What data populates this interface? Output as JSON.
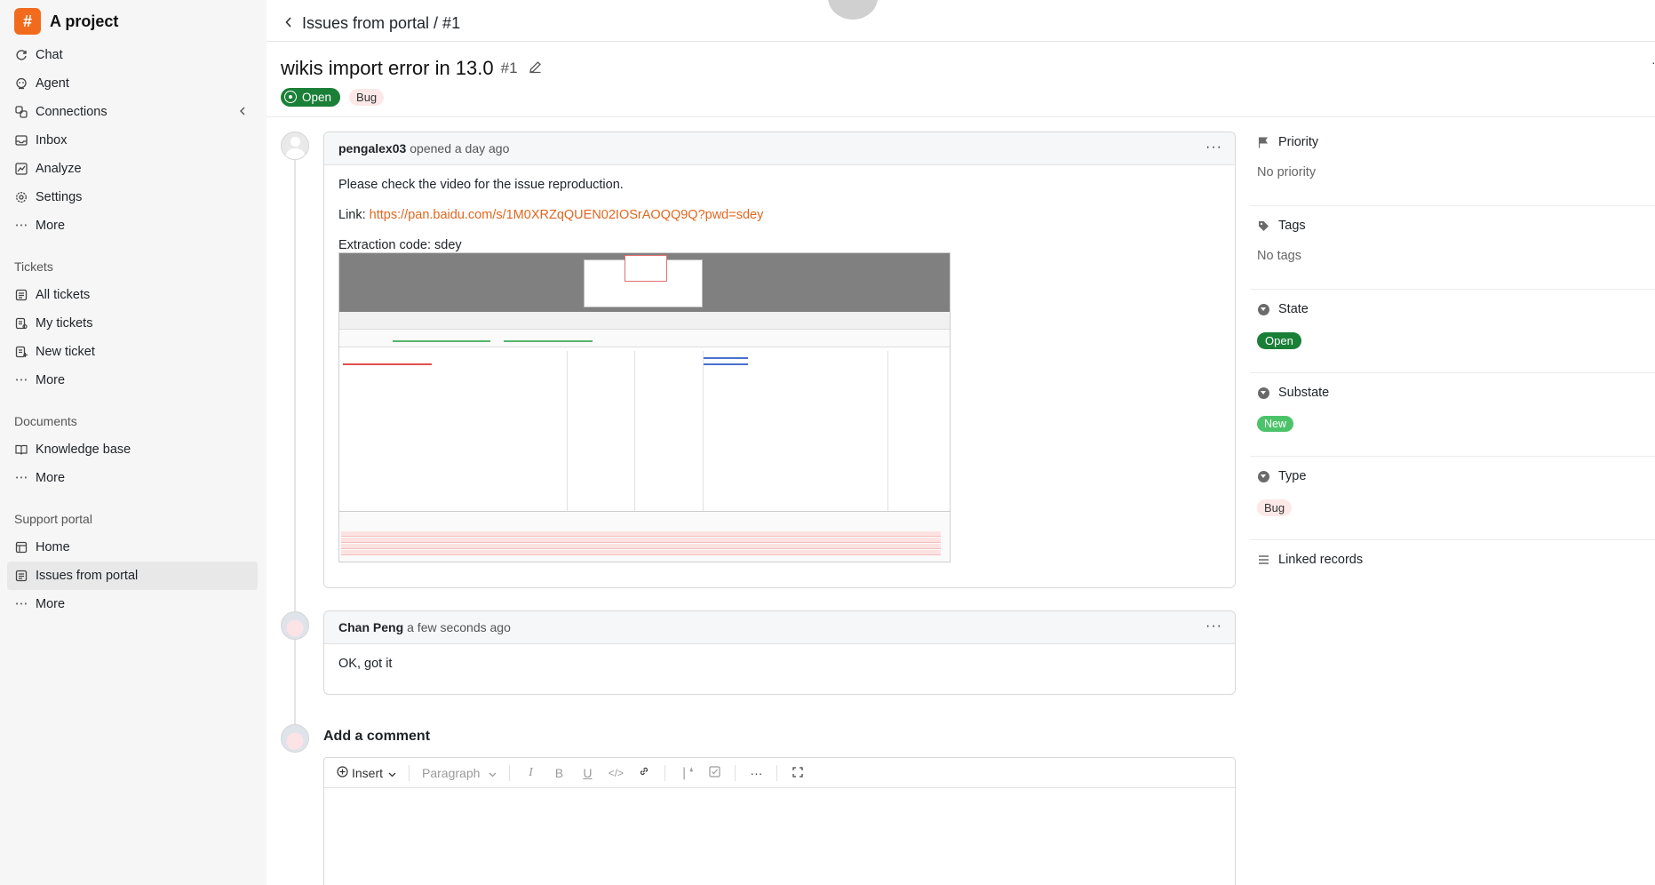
{
  "app": {
    "project_name": "A project"
  },
  "sidebar": {
    "main_items": [
      {
        "label": "Chat",
        "icon": "chat-icon"
      },
      {
        "label": "Agent",
        "icon": "agent-icon"
      },
      {
        "label": "Connections",
        "icon": "connections-icon"
      },
      {
        "label": "Inbox",
        "icon": "inbox-icon"
      },
      {
        "label": "Analyze",
        "icon": "analyze-icon"
      },
      {
        "label": "Settings",
        "icon": "settings-icon"
      },
      {
        "label": "More",
        "icon": "more-icon"
      }
    ],
    "tickets": {
      "title": "Tickets",
      "items": [
        {
          "label": "All tickets"
        },
        {
          "label": "My tickets"
        },
        {
          "label": "New ticket"
        },
        {
          "label": "More"
        }
      ]
    },
    "documents": {
      "title": "Documents",
      "items": [
        {
          "label": "Knowledge base"
        },
        {
          "label": "More"
        }
      ]
    },
    "support_portal": {
      "title": "Support portal",
      "items": [
        {
          "label": "Home"
        },
        {
          "label": "Issues from portal",
          "active": true
        },
        {
          "label": "More"
        }
      ]
    }
  },
  "header": {
    "breadcrumb": "Issues from portal / #1"
  },
  "issue": {
    "title": "wikis import error in 13.0",
    "number": "#1",
    "status": "Open",
    "label": "Bug"
  },
  "comments": [
    {
      "author": "pengalex03",
      "meta": "opened a day ago",
      "line1": "Please check the video for the issue reproduction.",
      "link_prefix": "Link: ",
      "link_text": "https://pan.baidu.com/s/1M0XRZqQUEN02IOSrAOQQ9Q?pwd=sdey",
      "line3": "Extraction code: sdey"
    },
    {
      "author": "Chan Peng",
      "meta": "a few seconds ago",
      "body": "OK, got it"
    }
  ],
  "add_comment": {
    "title": "Add a comment",
    "toolbar": {
      "insert_label": "Insert",
      "paragraph_label": "Paragraph"
    }
  },
  "properties": {
    "priority": {
      "label": "Priority",
      "value": "No priority"
    },
    "tags": {
      "label": "Tags",
      "value": "No tags"
    },
    "state": {
      "label": "State",
      "value": "Open"
    },
    "substate": {
      "label": "Substate",
      "value": "New"
    },
    "type": {
      "label": "Type",
      "value": "Bug"
    },
    "linked": {
      "label": "Linked records"
    }
  },
  "colors": {
    "brand": "#f26b1d",
    "open_green": "#1a7f37",
    "new_green": "#4cc36a",
    "bug_pink": "#fde8e8",
    "link_orange": "#e0671f"
  }
}
